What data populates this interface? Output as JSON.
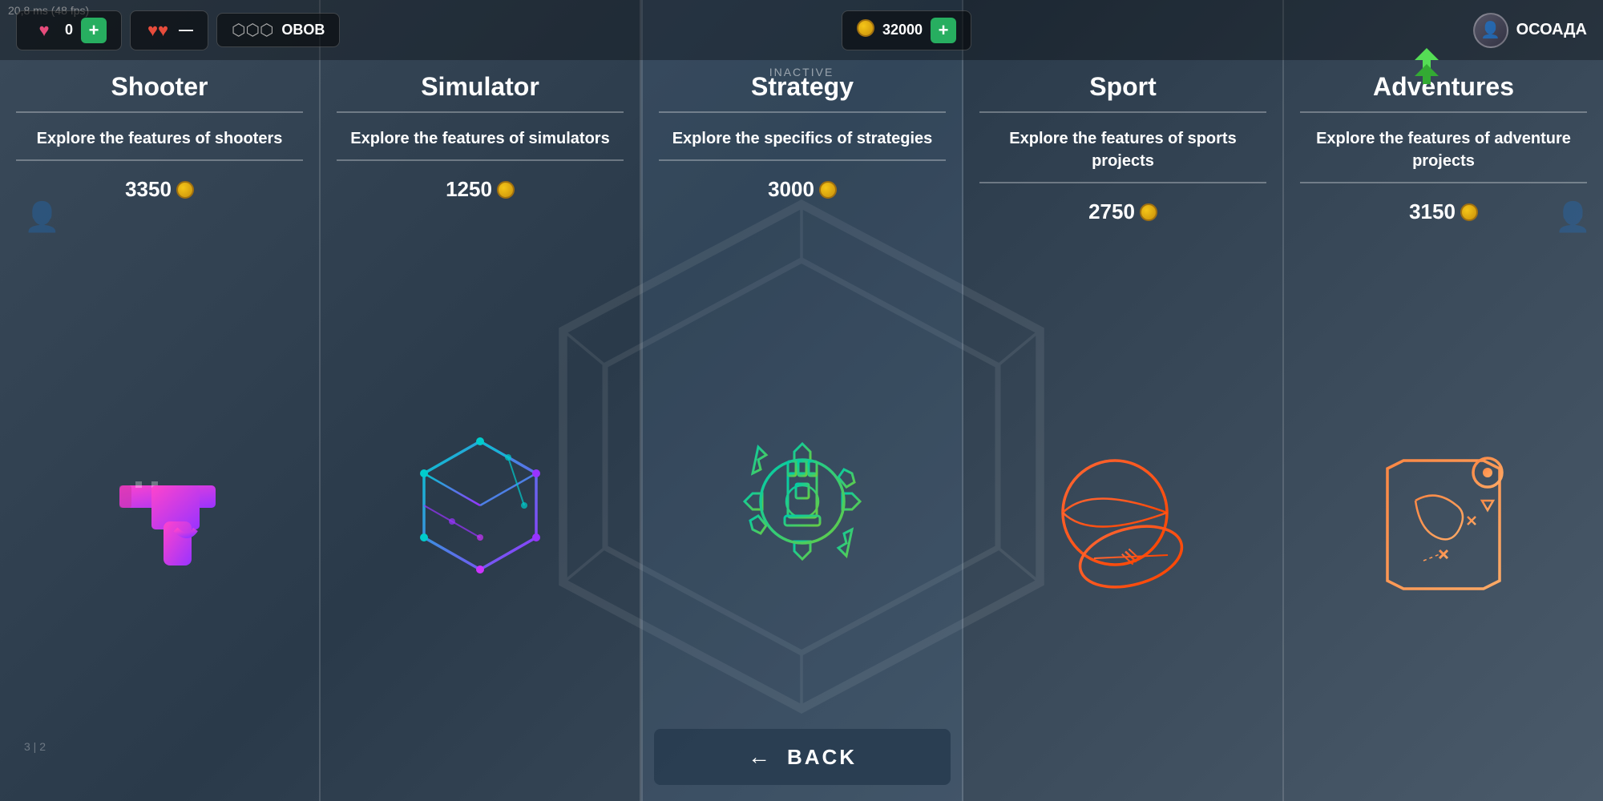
{
  "fps": "20,8 ms (48 fps)",
  "inactive_label": "INACTIVE",
  "hud": {
    "health_val": "0",
    "health_add": "+",
    "coins_val": "32000",
    "coins_add": "+",
    "username": "ОСОАДА",
    "rank_icon": "▲▲"
  },
  "columns": [
    {
      "id": "shooter",
      "title": "Shooter",
      "description": "Explore the features of shooters",
      "price": "3350",
      "icon_type": "gun",
      "icon_colors": [
        "#d946b0",
        "#9933ff"
      ]
    },
    {
      "id": "simulator",
      "title": "Simulator",
      "description": "Explore the features of simulators",
      "price": "1250",
      "icon_type": "cube",
      "icon_colors": [
        "#00cccc",
        "#9933ff"
      ]
    },
    {
      "id": "strategy",
      "title": "Strategy",
      "description": "Explore the specifics of strategies",
      "price": "3000",
      "icon_type": "chess-gear",
      "icon_colors": [
        "#00ccaa",
        "#66cc44"
      ]
    },
    {
      "id": "sport",
      "title": "Sport",
      "description": "Explore the features of sports projects",
      "price": "2750",
      "icon_type": "ball",
      "icon_colors": [
        "#ff6633",
        "#ff4400"
      ]
    },
    {
      "id": "adventures",
      "title": "Adventures",
      "description": "Explore the features of adventure projects",
      "price": "3150",
      "icon_type": "map",
      "icon_colors": [
        "#ff8844",
        "#ffaa66"
      ]
    }
  ],
  "back_button": {
    "label": "BACK"
  }
}
